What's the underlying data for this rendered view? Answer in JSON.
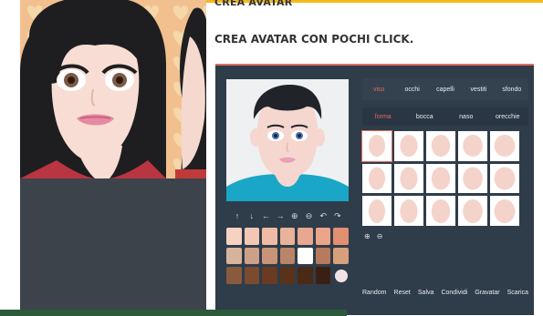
{
  "article": {
    "top_title": "CREA AVATAR",
    "headline": "CREA AVATAR CON POCHI CLICK."
  },
  "app": {
    "tabs": [
      {
        "label": "viso",
        "active": true
      },
      {
        "label": "occhi",
        "active": false
      },
      {
        "label": "capelli",
        "active": false
      },
      {
        "label": "vestiti",
        "active": false
      },
      {
        "label": "sfondo",
        "active": false
      }
    ],
    "subtabs": [
      {
        "label": "forma",
        "active": true
      },
      {
        "label": "bocca",
        "active": false
      },
      {
        "label": "naso",
        "active": false
      },
      {
        "label": "orecchie",
        "active": false
      }
    ],
    "tools": [
      {
        "glyph": "↑",
        "icon": "arrow-up-icon"
      },
      {
        "glyph": "↓",
        "icon": "arrow-down-icon"
      },
      {
        "glyph": "←",
        "icon": "arrow-left-icon"
      },
      {
        "glyph": "→",
        "icon": "arrow-right-icon"
      },
      {
        "glyph": "⊕",
        "icon": "zoom-in-icon"
      },
      {
        "glyph": "⊖",
        "icon": "zoom-out-icon"
      },
      {
        "glyph": "↶",
        "icon": "undo-icon"
      },
      {
        "glyph": "↷",
        "icon": "redo-icon"
      }
    ],
    "zoom_controls": [
      {
        "glyph": "⊕",
        "icon": "zoom-in-icon"
      },
      {
        "glyph": "⊖",
        "icon": "zoom-out-icon"
      }
    ],
    "palette": [
      "#f6d2c2",
      "#f2c7b3",
      "#efbba7",
      "#e9b29a",
      "#e7a790",
      "#eaa58a",
      "#e28f72",
      "#d7b39c",
      "#cda089",
      "#c89578",
      "#b98468",
      "#ffffff",
      "#b77a5d",
      "#d6a07a",
      "#8a5a3f",
      "#7a4b2f",
      "#6a3b22",
      "#5a3218",
      "#4a2a15",
      "#3a2012",
      "#f2e2e6"
    ],
    "shape_grid_count": 15,
    "selected_shape_index": 0,
    "actions": [
      "Random",
      "Reset",
      "Salva",
      "Condividi",
      "Gravatar",
      "Scarica"
    ]
  }
}
